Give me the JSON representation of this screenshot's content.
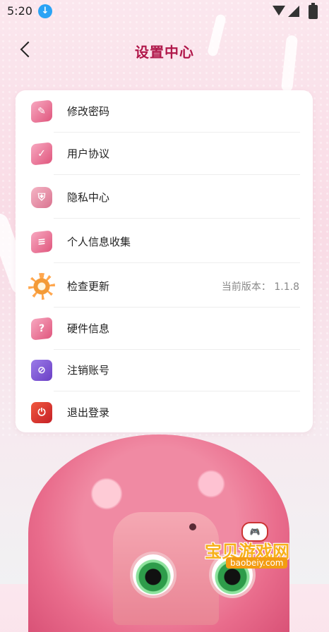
{
  "status_bar": {
    "time": "5:20",
    "icons": [
      "download-icon",
      "wifi-icon",
      "signal-icon",
      "battery-icon"
    ]
  },
  "header": {
    "title": "设置中心",
    "back_icon": "back-arrow-icon"
  },
  "settings": {
    "items": [
      {
        "label": "修改密码",
        "icon": "password-icon",
        "value": ""
      },
      {
        "label": "用户协议",
        "icon": "agreement-icon",
        "value": ""
      },
      {
        "label": "隐私中心",
        "icon": "shield-icon",
        "value": ""
      },
      {
        "label": "个人信息收集",
        "icon": "personal-info-icon",
        "value": ""
      },
      {
        "label": "检查更新",
        "icon": "gear-icon",
        "value": "当前版本： 1.1.8"
      },
      {
        "label": "硬件信息",
        "icon": "question-icon",
        "value": ""
      },
      {
        "label": "注销账号",
        "icon": "cancel-account-icon",
        "value": ""
      },
      {
        "label": "退出登录",
        "icon": "logout-icon",
        "value": ""
      }
    ]
  },
  "watermark": {
    "text": "宝贝游戏网",
    "url": "baobeiy.com"
  },
  "colors": {
    "title": "#b0174a",
    "background": "#fbe7ee",
    "card": "#ffffff",
    "value_text": "#888888"
  }
}
